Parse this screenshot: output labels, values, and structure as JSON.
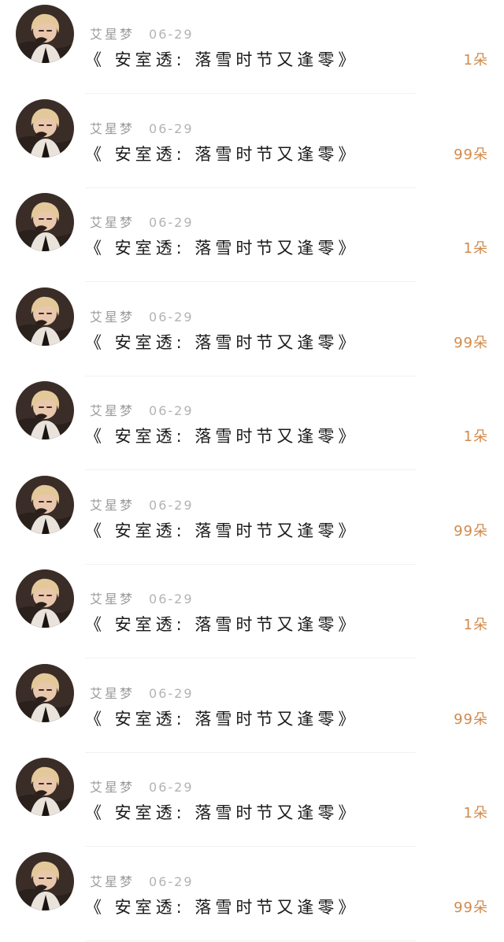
{
  "records": [
    {
      "name": "艾星梦",
      "date": "06-29",
      "title": "《 安室透: 落雪时节又逢零》",
      "amount": "1朵"
    },
    {
      "name": "艾星梦",
      "date": "06-29",
      "title": "《 安室透: 落雪时节又逢零》",
      "amount": "99朵"
    },
    {
      "name": "艾星梦",
      "date": "06-29",
      "title": "《 安室透: 落雪时节又逢零》",
      "amount": "1朵"
    },
    {
      "name": "艾星梦",
      "date": "06-29",
      "title": "《 安室透: 落雪时节又逢零》",
      "amount": "99朵"
    },
    {
      "name": "艾星梦",
      "date": "06-29",
      "title": "《 安室透: 落雪时节又逢零》",
      "amount": "1朵"
    },
    {
      "name": "艾星梦",
      "date": "06-29",
      "title": "《 安室透: 落雪时节又逢零》",
      "amount": "99朵"
    },
    {
      "name": "艾星梦",
      "date": "06-29",
      "title": "《 安室透: 落雪时节又逢零》",
      "amount": "1朵"
    },
    {
      "name": "艾星梦",
      "date": "06-29",
      "title": "《 安室透: 落雪时节又逢零》",
      "amount": "99朵"
    },
    {
      "name": "艾星梦",
      "date": "06-29",
      "title": "《 安室透: 落雪时节又逢零》",
      "amount": "1朵"
    },
    {
      "name": "艾星梦",
      "date": "06-29",
      "title": "《 安室透: 落雪时节又逢零》",
      "amount": "99朵"
    }
  ],
  "colors": {
    "amount": "#d18a4b",
    "meta": "#9a9a9a",
    "title": "#1a1a1a",
    "divider": "#f1f1f1"
  },
  "icons": {
    "avatar": "user-avatar-image"
  }
}
